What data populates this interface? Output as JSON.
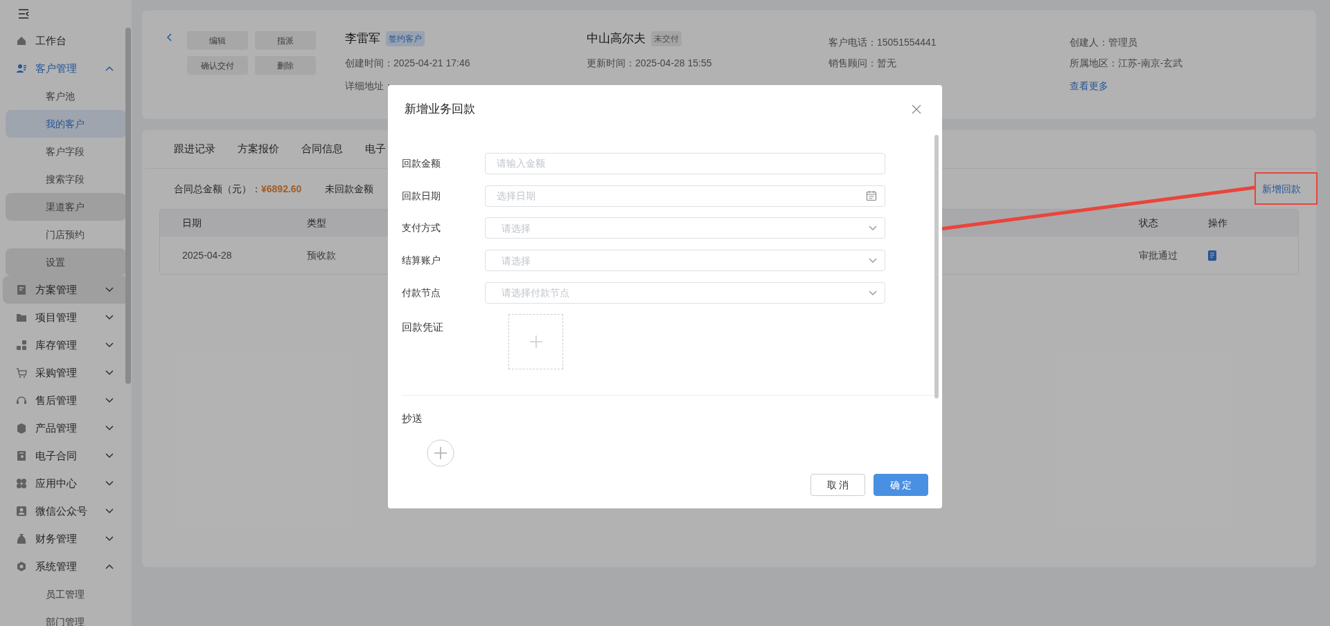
{
  "sidebar": {
    "items": [
      {
        "label": "工作台",
        "kind": "link",
        "active": false,
        "highlighted": false
      },
      {
        "label": "客户管理",
        "kind": "group",
        "expanded": true,
        "active": true,
        "highlighted": false,
        "children": [
          {
            "label": "客户池",
            "selected": false,
            "highlighted": false
          },
          {
            "label": "我的客户",
            "selected": true,
            "highlighted": false
          },
          {
            "label": "客户字段",
            "selected": false,
            "highlighted": false
          },
          {
            "label": "搜索字段",
            "selected": false,
            "highlighted": false
          },
          {
            "label": "渠道客户",
            "selected": false,
            "highlighted": true
          },
          {
            "label": "门店预约",
            "selected": false,
            "highlighted": false
          },
          {
            "label": "设置",
            "selected": false,
            "highlighted": true
          }
        ]
      },
      {
        "label": "方案管理",
        "kind": "group",
        "expanded": false,
        "active": false,
        "highlighted": true
      },
      {
        "label": "项目管理",
        "kind": "group",
        "expanded": false,
        "active": false,
        "highlighted": false
      },
      {
        "label": "库存管理",
        "kind": "group",
        "expanded": false,
        "active": false,
        "highlighted": false
      },
      {
        "label": "采购管理",
        "kind": "group",
        "expanded": false,
        "active": false,
        "highlighted": false
      },
      {
        "label": "售后管理",
        "kind": "group",
        "expanded": false,
        "active": false,
        "highlighted": false
      },
      {
        "label": "产品管理",
        "kind": "group",
        "expanded": false,
        "active": false,
        "highlighted": false
      },
      {
        "label": "电子合同",
        "kind": "group",
        "expanded": false,
        "active": false,
        "highlighted": false
      },
      {
        "label": "应用中心",
        "kind": "group",
        "expanded": false,
        "active": false,
        "highlighted": false
      },
      {
        "label": "微信公众号",
        "kind": "group",
        "expanded": false,
        "active": false,
        "highlighted": false
      },
      {
        "label": "财务管理",
        "kind": "group",
        "expanded": false,
        "active": false,
        "highlighted": false
      },
      {
        "label": "系统管理",
        "kind": "group",
        "expanded": true,
        "active": false,
        "highlighted": false,
        "children": [
          {
            "label": "员工管理",
            "selected": false,
            "highlighted": false
          },
          {
            "label": "部门管理",
            "selected": false,
            "highlighted": false
          }
        ]
      }
    ]
  },
  "header": {
    "buttons": [
      "编辑",
      "指派",
      "确认交付",
      "删除"
    ],
    "info_columns": [
      [
        {
          "kind": "name",
          "text": "李雷军",
          "tag": "签约客户",
          "tag_highlighted": true
        },
        {
          "kind": "text",
          "text": "创建时间：2025-04-21 17:46"
        },
        {
          "kind": "text",
          "text": "详细地址："
        }
      ],
      [
        {
          "kind": "name",
          "text": "中山高尔夫",
          "tag": "未交付",
          "tag_highlighted": false
        },
        {
          "kind": "text",
          "text": "更新时间：2025-04-28 15:55"
        }
      ],
      [
        {
          "kind": "text",
          "text": "客户电话：15051554441"
        },
        {
          "kind": "text",
          "text": "销售顾问：暂无"
        }
      ],
      [
        {
          "kind": "text",
          "text": "创建人：管理员"
        },
        {
          "kind": "text",
          "text": "所属地区：江苏-南京-玄武"
        },
        {
          "kind": "link",
          "text": "查看更多"
        }
      ]
    ]
  },
  "tabs": [
    {
      "label": "跟进记录",
      "selected": false
    },
    {
      "label": "方案报价",
      "selected": false
    },
    {
      "label": "合同信息",
      "selected": false
    },
    {
      "label": "电子",
      "selected": false
    }
  ],
  "summary": [
    {
      "label": "合同总金额（元）：",
      "value": "¥6892.60"
    },
    {
      "label": "未回款金额"
    }
  ],
  "add_link": "新增回款",
  "table": {
    "columns": [
      "日期",
      "类型",
      "状态",
      "操作"
    ],
    "rows": [
      {
        "cells": [
          "2025-04-28",
          "预收款",
          "审批通过"
        ]
      }
    ]
  },
  "dialog": {
    "title": "新增业务回款",
    "fields": [
      {
        "label": "回款金额",
        "kind": "input",
        "placeholder": "请输入金额"
      },
      {
        "label": "回款日期",
        "kind": "date",
        "placeholder": "选择日期"
      },
      {
        "label": "支付方式",
        "kind": "select",
        "placeholder": "请选择"
      },
      {
        "label": "结算账户",
        "kind": "select",
        "placeholder": "请选择"
      },
      {
        "label": "付款节点",
        "kind": "select",
        "placeholder": "请选择付款节点"
      },
      {
        "label": "回款凭证",
        "kind": "upload"
      }
    ],
    "cc_label": "抄送",
    "buttons": [
      {
        "label": "取 消",
        "kind": "default"
      },
      {
        "label": "确 定",
        "kind": "primary"
      }
    ]
  }
}
